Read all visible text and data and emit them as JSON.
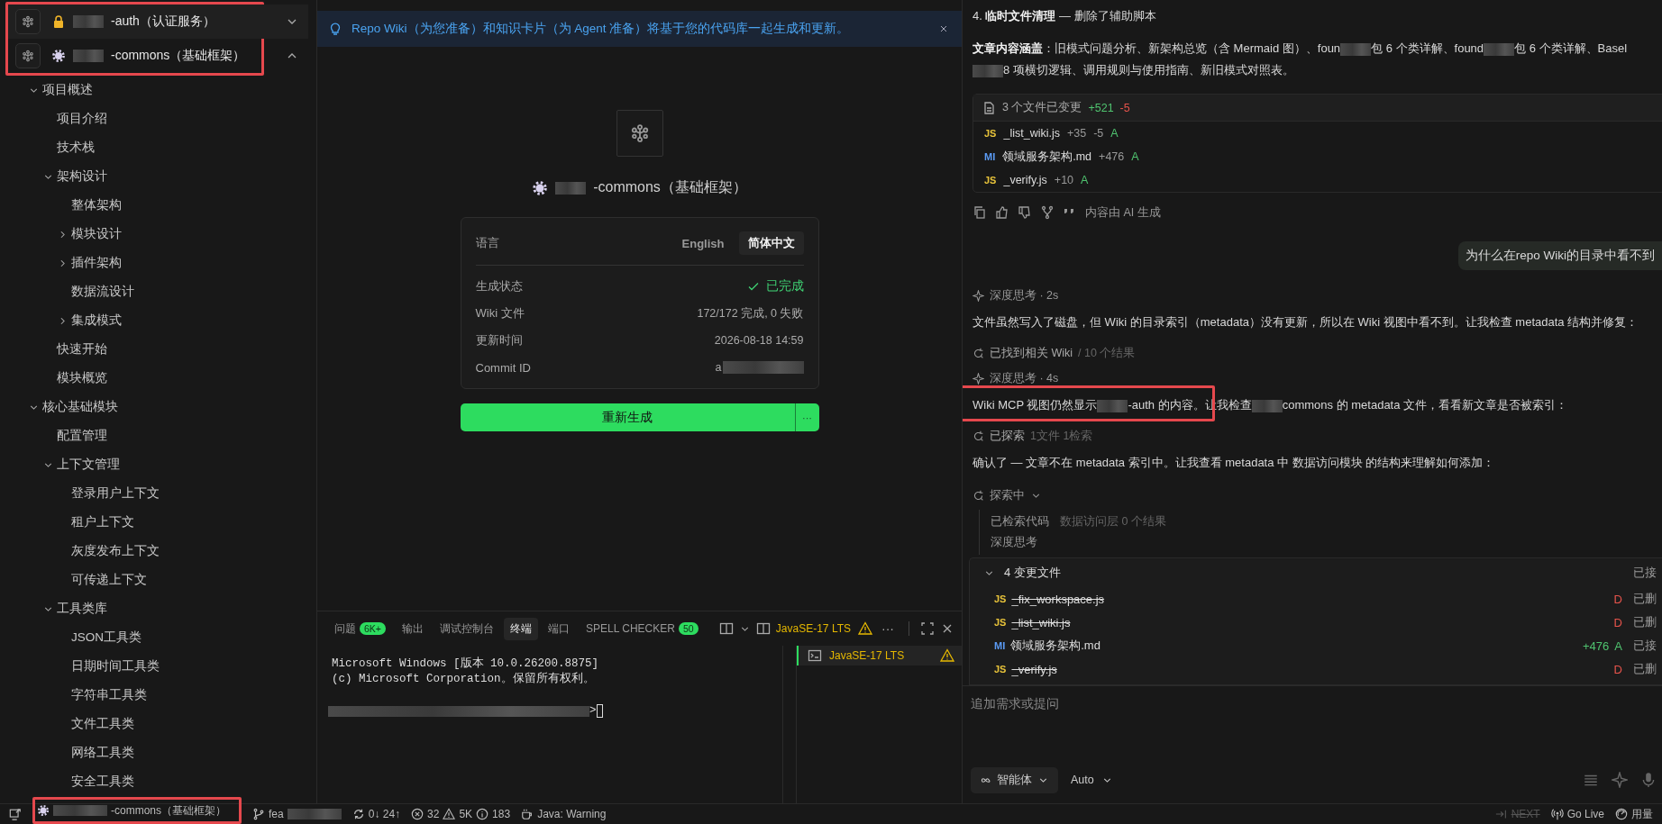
{
  "sidebar": {
    "highlighted": true,
    "repos": [
      {
        "kind": "lock",
        "name": [
          {
            "kind": "redacted"
          },
          {
            "kind": "text",
            "text": "-auth（认证服务）"
          }
        ],
        "expanded": false
      },
      {
        "kind": "gear",
        "name": [
          {
            "kind": "redacted"
          },
          {
            "kind": "text",
            "text": "-commons（基础框架）"
          }
        ],
        "expanded": true
      }
    ],
    "tree": [
      {
        "label": "项目概述",
        "expanded": true,
        "children": [
          {
            "label": "项目介绍"
          },
          {
            "label": "技术栈"
          },
          {
            "label": "架构设计",
            "expanded": true,
            "children": [
              {
                "label": "整体架构"
              },
              {
                "label": "模块设计",
                "expanded": false
              },
              {
                "label": "插件架构",
                "expanded": false
              },
              {
                "label": "数据流设计"
              },
              {
                "label": "集成模式",
                "expanded": false
              }
            ]
          },
          {
            "label": "快速开始"
          },
          {
            "label": "模块概览"
          }
        ]
      },
      {
        "label": "核心基础模块",
        "expanded": true,
        "children": [
          {
            "label": "配置管理"
          },
          {
            "label": "上下文管理",
            "expanded": true,
            "children": [
              {
                "label": "登录用户上下文"
              },
              {
                "label": "租户上下文"
              },
              {
                "label": "灰度发布上下文"
              },
              {
                "label": "可传递上下文"
              }
            ]
          },
          {
            "label": "工具类库",
            "expanded": true,
            "children": [
              {
                "label": "JSON工具类"
              },
              {
                "label": "日期时间工具类"
              },
              {
                "label": "字符串工具类"
              },
              {
                "label": "文件工具类"
              },
              {
                "label": "网络工具类"
              },
              {
                "label": "安全工具类"
              }
            ]
          }
        ]
      }
    ]
  },
  "banner": {
    "text": "Repo Wiki（为您准备）和知识卡片（为 Agent 准备）将基于您的代码库一起生成和更新。"
  },
  "wiki": {
    "title": [
      {
        "kind": "redacted"
      },
      {
        "kind": "text",
        "text": "-commons（基础框架）"
      }
    ],
    "language": {
      "label": "语言",
      "options": [
        {
          "label": "English",
          "selected": false
        },
        {
          "label": "简体中文",
          "selected": true
        }
      ]
    },
    "rows": [
      {
        "label": "生成状态",
        "value": "已完成",
        "kind": "status"
      },
      {
        "label": "Wiki 文件",
        "value": "172/172 完成, 0 失败",
        "kind": "text"
      },
      {
        "label": "更新时间",
        "value": "2026-08-18 14:59",
        "kind": "text"
      },
      {
        "label": "Commit ID",
        "value": "a",
        "kind": "redacted"
      }
    ],
    "regenerate": "重新生成",
    "more": "···"
  },
  "panel": {
    "tabs": [
      {
        "label": "问题",
        "badge": "6K+",
        "selected": false
      },
      {
        "label": "输出",
        "selected": false
      },
      {
        "label": "调试控制台",
        "selected": false
      },
      {
        "label": "终端",
        "selected": true
      },
      {
        "label": "端口",
        "selected": false
      },
      {
        "label": "SPELL CHECKER",
        "badge": "50",
        "selected": false
      }
    ],
    "terminal_name": "JavaSE-17 LTS",
    "more": "···",
    "lines": [
      "Microsoft Windows [版本 10.0.26200.8875]",
      "(c) Microsoft Corporation。保留所有权利。"
    ],
    "prompt": ">",
    "terminals": [
      {
        "label": "JavaSE-17 LTS",
        "selected": true
      }
    ]
  },
  "chat": {
    "items": [
      {
        "kind": "text",
        "segments": [
          {
            "kind": "text",
            "text": "4. **临时文件清理** — 删除了辅助脚本"
          }
        ]
      },
      {
        "kind": "text",
        "segments": [
          {
            "kind": "text",
            "text": "**文章内容涵盖**：旧模式问题分析、新架构总览（含 Mermaid 图）、foun"
          },
          {
            "kind": "redacted"
          },
          {
            "kind": "text",
            "text": "包 6 个类详解、found"
          },
          {
            "kind": "redacted"
          },
          {
            "kind": "text",
            "text": "包 6 个类详解、"
          },
          {
            "kind": "text",
            "text": "Basel"
          },
          {
            "kind": "redacted"
          },
          {
            "kind": "text",
            "text": "8 项横切逻辑、调用规则与使用指南、新旧模式对照表。"
          }
        ]
      },
      {
        "kind": "files",
        "summary": "3 个文件已变更",
        "added": "+521",
        "removed": "-5",
        "files": [
          {
            "kind": "js",
            "badge": "JS",
            "name": "_list_wiki.js",
            "added": "+35",
            "removed": "-5",
            "status": "A"
          },
          {
            "kind": "md",
            "badge": "MI",
            "name": "领域服务架构.md",
            "added": "+476",
            "status": "A"
          },
          {
            "kind": "js",
            "badge": "JS",
            "name": "_verify.js",
            "added": "+10",
            "status": "A"
          }
        ]
      },
      {
        "kind": "actions",
        "note": "内容由 AI 生成"
      },
      {
        "kind": "user",
        "text": "为什么在repo Wiki的目录中看不到"
      },
      {
        "kind": "thought",
        "text": "深度思考 · 2s"
      },
      {
        "kind": "text",
        "segments": [
          {
            "kind": "text",
            "text": "文件虽然写入了磁盘，但 Wiki 的目录索引（metadata）没有更新，所以在 Wiki 视图中看不到。让我检查 metadata 结构并修复："
          }
        ]
      },
      {
        "kind": "tool",
        "text": "已找到相关 Wiki",
        "detail": "/ 10 个结果"
      },
      {
        "kind": "thought",
        "text": "深度思考 · 4s"
      },
      {
        "kind": "text",
        "highlighted": true,
        "segments": [
          {
            "kind": "text",
            "text": "Wiki MCP 视图仍然显示"
          },
          {
            "kind": "redacted"
          },
          {
            "kind": "text",
            "text": "-auth 的内容。让我检查"
          },
          {
            "kind": "redacted"
          },
          {
            "kind": "text",
            "text": "commons 的 metadata 文件，看看新文章是否被索引："
          }
        ]
      },
      {
        "kind": "tool",
        "text": "已探索",
        "detail": "1文件 1检索"
      },
      {
        "kind": "text",
        "segments": [
          {
            "kind": "text",
            "text": "确认了 — 文章不在 metadata 索引中。让我查看 metadata 中 数据访问模块 的结构来理解如何添加："
          }
        ]
      },
      {
        "kind": "progress",
        "text": "探索中",
        "steps": [
          {
            "text": "已检索代码",
            "detail": "数据访问层 0 个结果"
          },
          {
            "text": "深度思考"
          }
        ]
      }
    ],
    "changes": {
      "expanded": true,
      "title": "4 变更文件",
      "action": "已接",
      "files": [
        {
          "kind": "js",
          "badge": "JS",
          "name": "_fix_workspace.js",
          "deleted": true,
          "status": "D",
          "state": "已删"
        },
        {
          "kind": "js",
          "badge": "JS",
          "name": "_list_wiki.js",
          "deleted": true,
          "status": "D",
          "state": "已删"
        },
        {
          "kind": "md",
          "badge": "MI",
          "name": "领域服务架构.md",
          "deleted": false,
          "added": "+476",
          "status": "A",
          "state": "已接"
        },
        {
          "kind": "js",
          "badge": "JS",
          "name": "_verify.js",
          "deleted": true,
          "status": "D",
          "state": "已删"
        }
      ]
    },
    "input": {
      "placeholder": "追加需求或提问",
      "mode": "智能体",
      "model": "Auto"
    }
  },
  "status_bar": {
    "left": [
      {
        "kind": "remote"
      },
      {
        "kind": "repo",
        "highlighted": true,
        "segments": [
          {
            "kind": "redacted"
          },
          {
            "kind": "text",
            "text": "-commons（基础框架）"
          }
        ]
      },
      {
        "kind": "branch",
        "segments": [
          {
            "kind": "text",
            "text": "fea"
          },
          {
            "kind": "redacted"
          }
        ]
      },
      {
        "kind": "sync",
        "text": "0↓ 24↑"
      },
      {
        "kind": "problems",
        "errors": "32",
        "warnings": "5K",
        "infos": "183"
      },
      {
        "kind": "java",
        "text": "Java: Warning"
      }
    ],
    "right": [
      {
        "kind": "next",
        "text": "NEXT"
      },
      {
        "kind": "live",
        "text": "Go Live"
      },
      {
        "kind": "usage",
        "text": "用量"
      }
    ]
  }
}
